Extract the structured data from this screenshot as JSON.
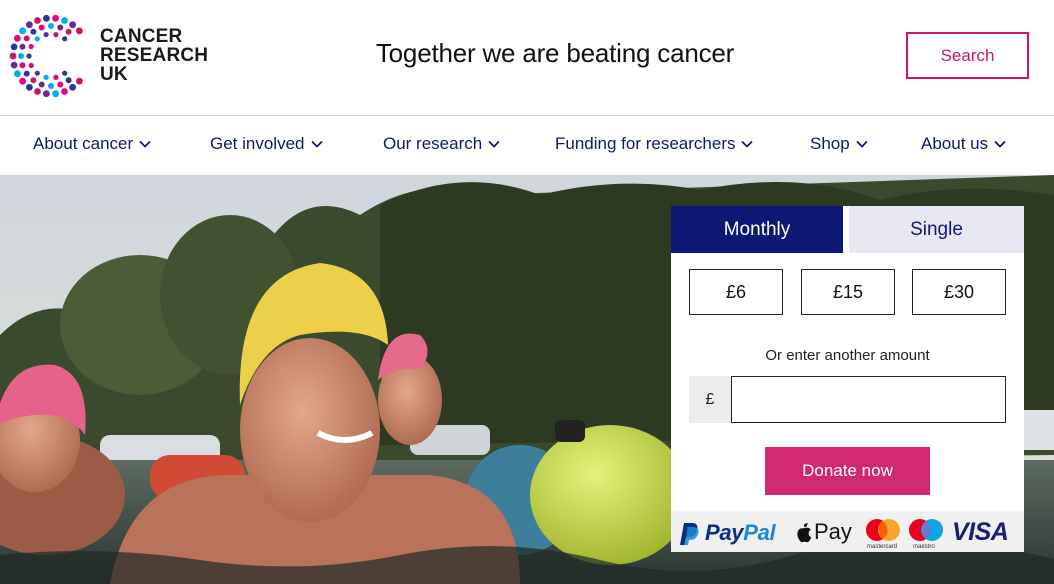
{
  "brand": {
    "name_lines": [
      "CANCER",
      "RESEARCH",
      "UK"
    ],
    "tagline": "Together we are beating cancer",
    "colors": {
      "magenta": "#c91668",
      "navy": "#0c1874",
      "donate": "#d1296f"
    }
  },
  "header": {
    "search_label": "Search"
  },
  "nav": {
    "items": [
      {
        "label": "About cancer",
        "icon": "chevron-down-icon"
      },
      {
        "label": "Get involved",
        "icon": "chevron-down-icon"
      },
      {
        "label": "Our research",
        "icon": "chevron-down-icon"
      },
      {
        "label": "Funding for researchers",
        "icon": "chevron-down-icon"
      },
      {
        "label": "Shop",
        "icon": "chevron-down-icon"
      },
      {
        "label": "About us",
        "icon": "chevron-down-icon"
      }
    ]
  },
  "donation": {
    "tabs": [
      "Monthly",
      "Single"
    ],
    "selected_tab": "Monthly",
    "amounts": [
      "£6",
      "£15",
      "£30"
    ],
    "other_amount_label": "Or enter another amount",
    "currency_symbol": "£",
    "amount_value": "",
    "donate_label": "Donate now",
    "payment_methods": {
      "paypal": "PayPal",
      "applepay": "Pay",
      "mastercard": "mastercard",
      "maestro": "maestro",
      "visa": "VISA"
    }
  }
}
